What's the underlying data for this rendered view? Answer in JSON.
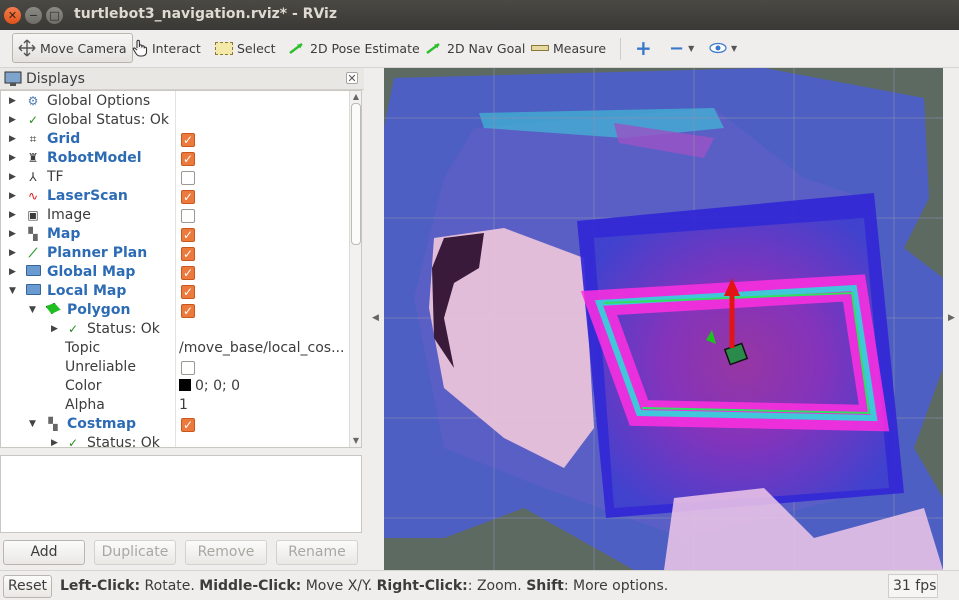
{
  "window": {
    "title": "turtlebot3_navigation.rviz* - RViz"
  },
  "toolbar": {
    "move_camera": "Move Camera",
    "interact": "Interact",
    "select": "Select",
    "pose_estimate": "2D Pose Estimate",
    "nav_goal": "2D Nav Goal",
    "measure": "Measure"
  },
  "displays": {
    "title": "Displays",
    "rows": [
      {
        "label": "Global Options",
        "icon": "gear-icon"
      },
      {
        "label": "Global Status: Ok",
        "icon": "check-icon"
      },
      {
        "label": "Grid",
        "icon": "grid-icon",
        "checked": true
      },
      {
        "label": "RobotModel",
        "icon": "robot-icon",
        "checked": true
      },
      {
        "label": "TF",
        "icon": "axes-icon",
        "checked": false
      },
      {
        "label": "LaserScan",
        "icon": "laser-icon",
        "checked": true
      },
      {
        "label": "Image",
        "icon": "image-icon",
        "checked": false
      },
      {
        "label": "Map",
        "icon": "map-icon",
        "checked": true
      },
      {
        "label": "Planner Plan",
        "icon": "path-icon",
        "checked": true
      },
      {
        "label": "Global Map",
        "icon": "folder-icon",
        "checked": true
      },
      {
        "label": "Local Map",
        "icon": "folder-icon",
        "checked": true
      },
      {
        "label": "Polygon",
        "icon": "polygon-icon",
        "checked": true
      },
      {
        "label": "Status: Ok",
        "icon": "check-icon"
      },
      {
        "label": "Topic",
        "value": "/move_base/local_cos..."
      },
      {
        "label": "Unreliable",
        "checked": false
      },
      {
        "label": "Color",
        "value": "0; 0; 0"
      },
      {
        "label": "Alpha",
        "value": "1"
      },
      {
        "label": "Costmap",
        "icon": "map-icon",
        "checked": true
      },
      {
        "label": "Status: Ok",
        "icon": "check-icon"
      }
    ]
  },
  "buttons": {
    "add": "Add",
    "duplicate": "Duplicate",
    "remove": "Remove",
    "rename": "Rename"
  },
  "status": {
    "reset": "Reset",
    "left_click": "Left-Click:",
    "left_action": " Rotate. ",
    "middle_click": "Middle-Click:",
    "middle_action": " Move X/Y. ",
    "right_click": "Right-Click:",
    "right_action": ": Zoom. ",
    "shift": "Shift",
    "shift_action": ": More options.",
    "fps": "31 fps"
  },
  "colors": {
    "accent": "#ec7a3c",
    "link_blue": "#2d6cb5",
    "ok_green": "#2a8a1f"
  }
}
